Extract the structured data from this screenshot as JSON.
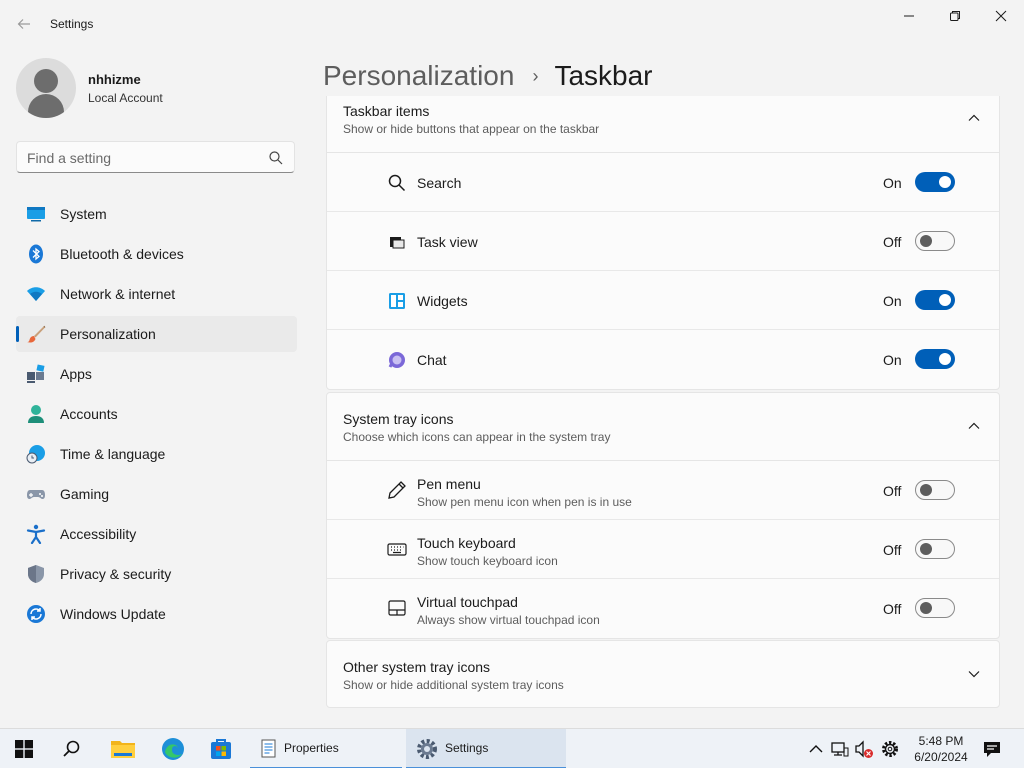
{
  "window": {
    "title": "Settings",
    "controls": {
      "minimize": "minimize-icon",
      "maximize": "restore-icon",
      "close": "close-icon"
    }
  },
  "profile": {
    "name": "nhhizme",
    "account_type": "Local Account"
  },
  "search": {
    "placeholder": "Find a setting"
  },
  "nav": {
    "items": [
      {
        "label": "System",
        "icon": "monitor-icon"
      },
      {
        "label": "Bluetooth & devices",
        "icon": "bluetooth-icon"
      },
      {
        "label": "Network & internet",
        "icon": "wifi-icon"
      },
      {
        "label": "Personalization",
        "icon": "brush-icon",
        "selected": true
      },
      {
        "label": "Apps",
        "icon": "apps-icon"
      },
      {
        "label": "Accounts",
        "icon": "person-icon"
      },
      {
        "label": "Time & language",
        "icon": "clock-globe-icon"
      },
      {
        "label": "Gaming",
        "icon": "gamepad-icon"
      },
      {
        "label": "Accessibility",
        "icon": "accessibility-icon"
      },
      {
        "label": "Privacy & security",
        "icon": "shield-icon"
      },
      {
        "label": "Windows Update",
        "icon": "update-icon"
      }
    ]
  },
  "breadcrumb": {
    "parent": "Personalization",
    "separator": "›",
    "current": "Taskbar"
  },
  "taskbar_items": {
    "title": "Taskbar items",
    "subtitle": "Show or hide buttons that appear on the taskbar",
    "items": [
      {
        "label": "Search",
        "state": "On",
        "on": true,
        "icon": "search-icon"
      },
      {
        "label": "Task view",
        "state": "Off",
        "on": false,
        "icon": "task-view-icon"
      },
      {
        "label": "Widgets",
        "state": "On",
        "on": true,
        "icon": "widgets-icon"
      },
      {
        "label": "Chat",
        "state": "On",
        "on": true,
        "icon": "chat-icon"
      }
    ]
  },
  "system_tray": {
    "title": "System tray icons",
    "subtitle": "Choose which icons can appear in the system tray",
    "items": [
      {
        "label": "Pen menu",
        "desc": "Show pen menu icon when pen is in use",
        "state": "Off",
        "on": false,
        "icon": "pen-icon"
      },
      {
        "label": "Touch keyboard",
        "desc": "Show touch keyboard icon",
        "state": "Off",
        "on": false,
        "icon": "keyboard-icon"
      },
      {
        "label": "Virtual touchpad",
        "desc": "Always show virtual touchpad icon",
        "state": "Off",
        "on": false,
        "icon": "touchpad-icon"
      }
    ]
  },
  "other_tray": {
    "title": "Other system tray icons",
    "subtitle": "Show or hide additional system tray icons"
  },
  "taskbar": {
    "apps": [
      {
        "label": "Properties",
        "icon": "properties-icon"
      },
      {
        "label": "Settings",
        "icon": "settings-gear-icon",
        "active": true
      }
    ],
    "time": "5:48 PM",
    "date": "6/20/2024"
  },
  "colors": {
    "accent": "#005fb8",
    "background": "#f3f3f3",
    "card": "#fbfbfb"
  }
}
